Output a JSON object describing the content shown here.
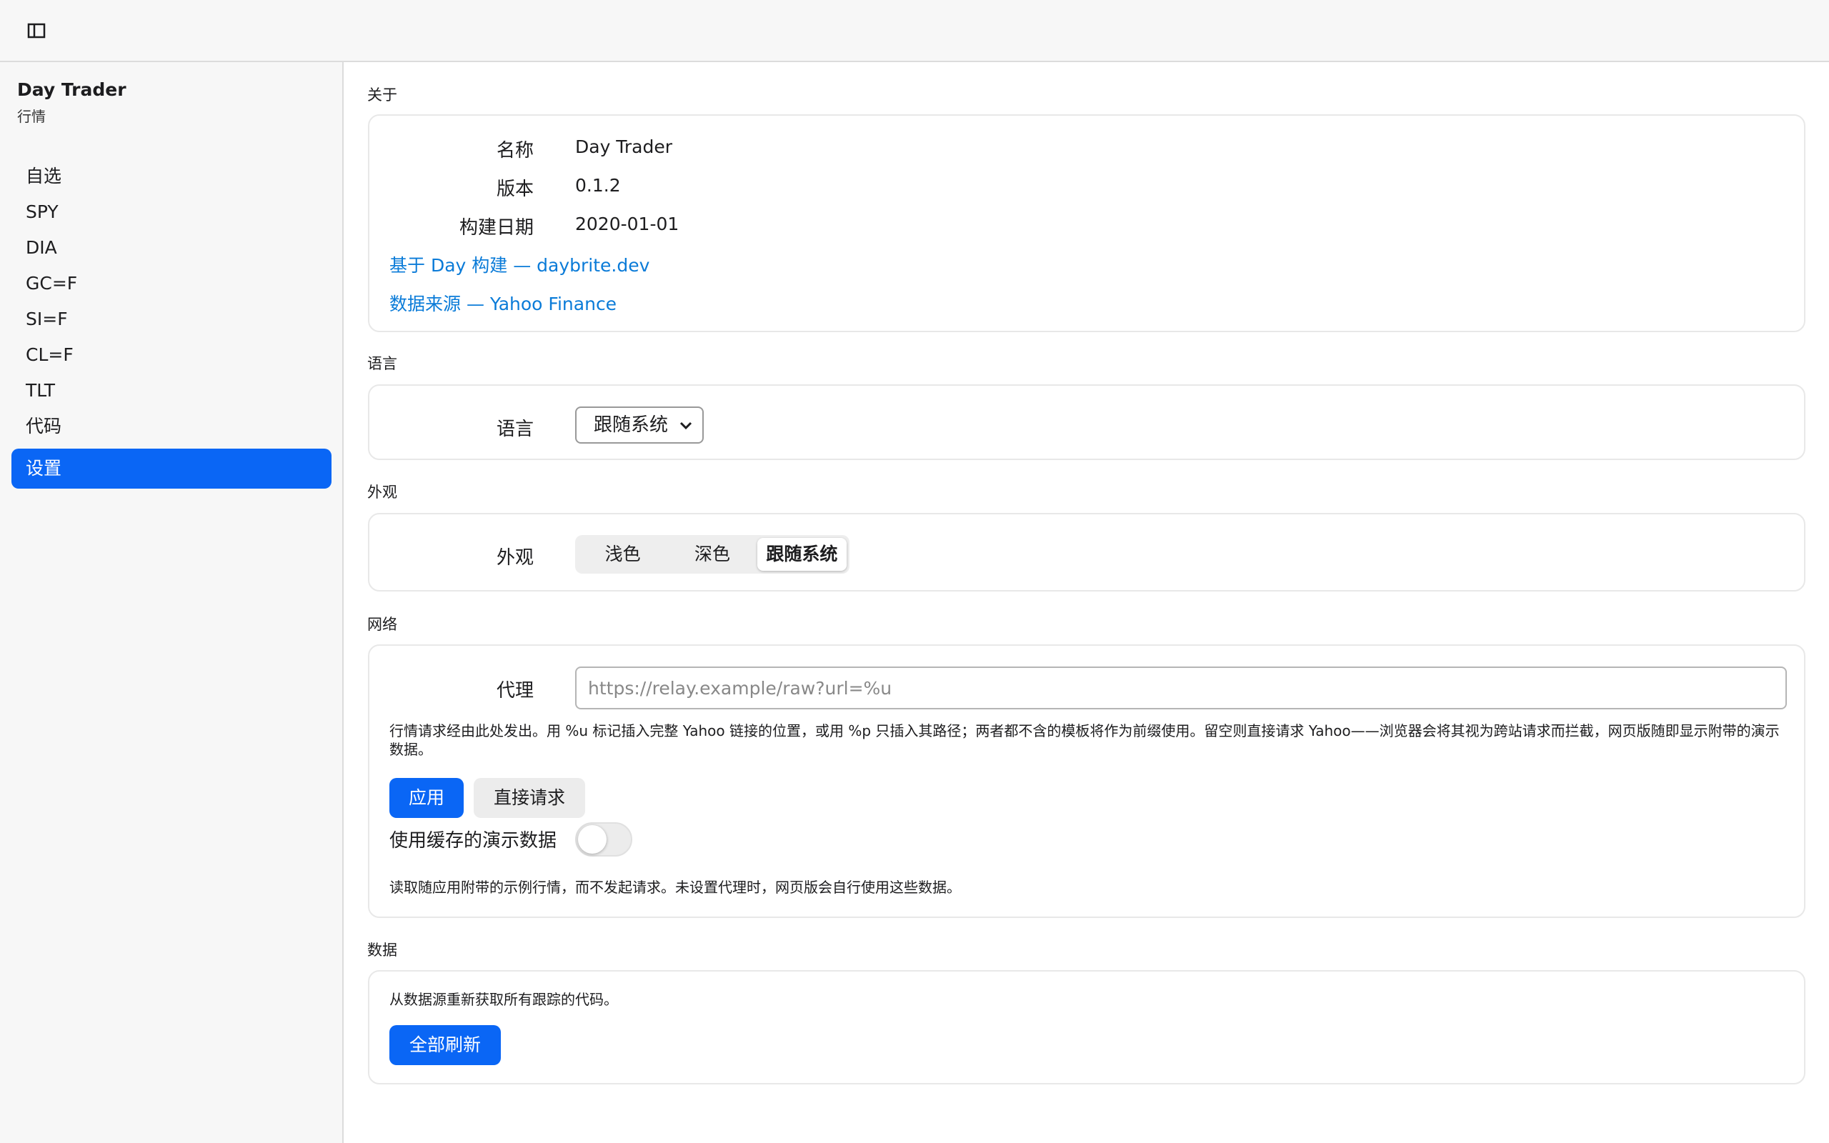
{
  "app": {
    "title": "Day Trader",
    "subtitle": "行情"
  },
  "sidebar": {
    "items": [
      {
        "label": "自选",
        "active": false
      },
      {
        "label": "SPY",
        "active": false
      },
      {
        "label": "DIA",
        "active": false
      },
      {
        "label": "GC=F",
        "active": false
      },
      {
        "label": "SI=F",
        "active": false
      },
      {
        "label": "CL=F",
        "active": false
      },
      {
        "label": "TLT",
        "active": false
      },
      {
        "label": "代码",
        "active": false
      },
      {
        "label": "设置",
        "active": true
      }
    ]
  },
  "about": {
    "section_label": "关于",
    "name_label": "名称",
    "name_value": "Day Trader",
    "version_label": "版本",
    "version_value": "0.1.2",
    "build_label": "构建日期",
    "build_value": "2020-01-01",
    "link_built": "基于 Day 构建 — daybrite.dev",
    "link_source": "数据来源 — Yahoo Finance"
  },
  "language": {
    "section_label": "语言",
    "label": "语言",
    "selected": "跟随系统"
  },
  "appearance": {
    "section_label": "外观",
    "label": "外观",
    "options": [
      "浅色",
      "深色",
      "跟随系统"
    ],
    "selected_index": 2
  },
  "network": {
    "section_label": "网络",
    "proxy_label": "代理",
    "proxy_value": "",
    "proxy_placeholder": "https://relay.example/raw?url=%u",
    "help": "行情请求经由此处发出。用 %u 标记插入完整 Yahoo 链接的位置，或用 %p 只插入其路径；两者都不含的模板将作为前缀使用。留空则直接请求 Yahoo——浏览器会将其视为跨站请求而拦截，网页版随即显示附带的演示数据。",
    "apply_label": "应用",
    "direct_label": "直接请求",
    "demo_label": "使用缓存的演示数据",
    "demo_on": false,
    "demo_help": "读取随应用附带的示例行情，而不发起请求。未设置代理时，网页版会自行使用这些数据。"
  },
  "data": {
    "section_label": "数据",
    "help": "从数据源重新获取所有跟踪的代码。",
    "refresh_label": "全部刷新"
  },
  "colors": {
    "accent": "#0a66f5",
    "link": "#0a7bd8"
  }
}
